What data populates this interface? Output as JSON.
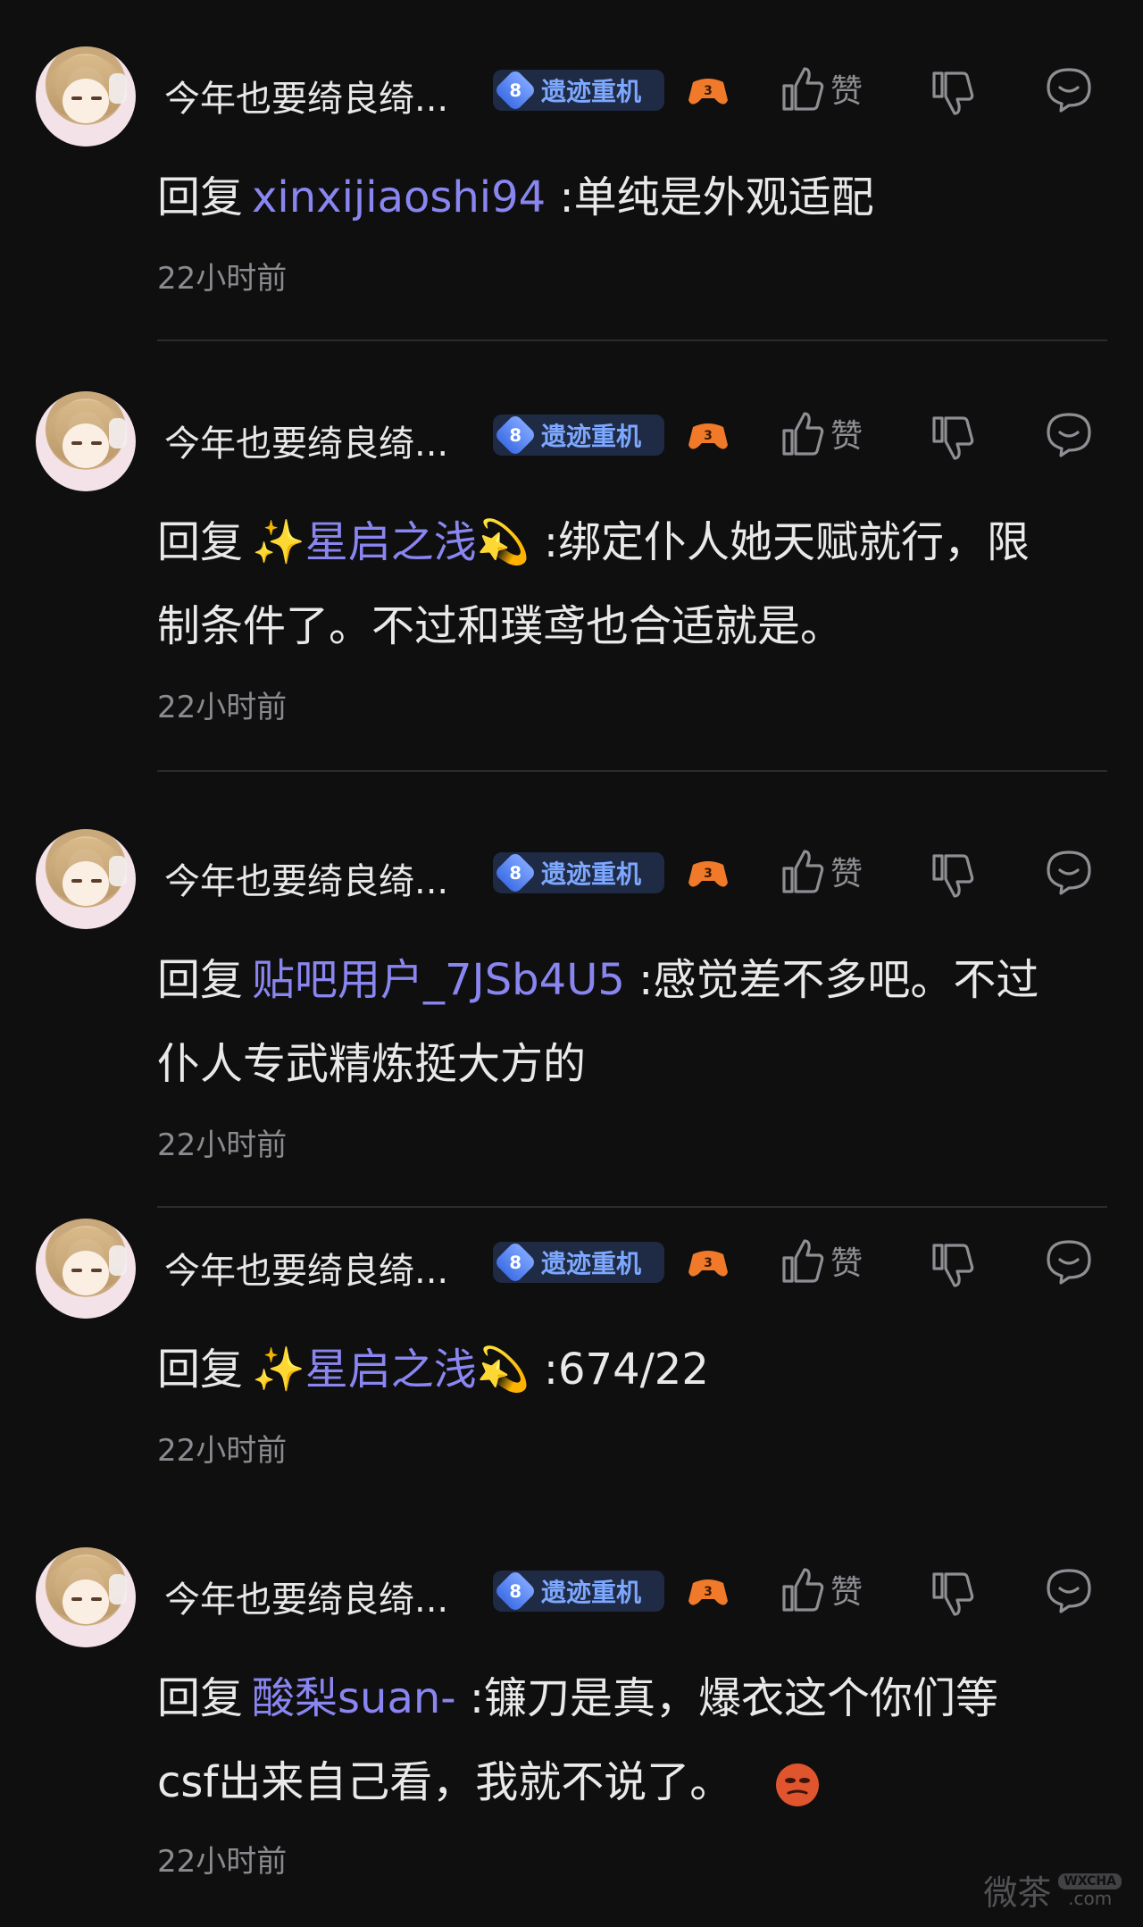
{
  "replies": [
    {
      "username": "今年也要绮良绮...",
      "badge_level": "8",
      "badge_text": "遗迹重机",
      "like_label": "赞",
      "prefix": "回复",
      "target": "xinxijiaoshi94",
      "line1": ":单纯是外观适配",
      "line2": "",
      "time": "22小时前"
    },
    {
      "username": "今年也要绮良绮...",
      "badge_level": "8",
      "badge_text": "遗迹重机",
      "like_label": "赞",
      "prefix": "回复",
      "target": "✨星启之浅💫",
      "line1": ":绑定仆人她天赋就行，限",
      "line2": "制条件了。不过和璞鸢也合适就是。",
      "time": "22小时前"
    },
    {
      "username": "今年也要绮良绮...",
      "badge_level": "8",
      "badge_text": "遗迹重机",
      "like_label": "赞",
      "prefix": "回复",
      "target": "贴吧用户_7JSb4U5",
      "line1": ":感觉差不多吧。不过",
      "line2": "仆人专武精炼挺大方的",
      "time": "22小时前"
    },
    {
      "username": "今年也要绮良绮...",
      "badge_level": "8",
      "badge_text": "遗迹重机",
      "like_label": "赞",
      "prefix": "回复",
      "target": "✨星启之浅💫",
      "line1": ":674/22",
      "line2": "",
      "time": "22小时前"
    },
    {
      "username": "今年也要绮良绮...",
      "badge_level": "8",
      "badge_text": "遗迹重机",
      "like_label": "赞",
      "prefix": "回复",
      "target": "酸梨suan-",
      "line1": ":镰刀是真，爆衣这个你们等",
      "line2": "csf出来自己看，我就不说了。",
      "time": "22小时前"
    }
  ],
  "watermark": {
    "text": "微茶",
    "tag": "WXCHA",
    "domain": ".com"
  },
  "colors": {
    "background": "#0f0f10",
    "link": "#8a86f1",
    "badge": "#7da8ff",
    "muted": "#8a8a8f"
  },
  "icons": [
    "avatar",
    "level-badge-icon",
    "game-controller-icon",
    "thumbs-up-icon",
    "thumbs-down-icon",
    "reply-bubble-icon",
    "emoji-icon"
  ]
}
